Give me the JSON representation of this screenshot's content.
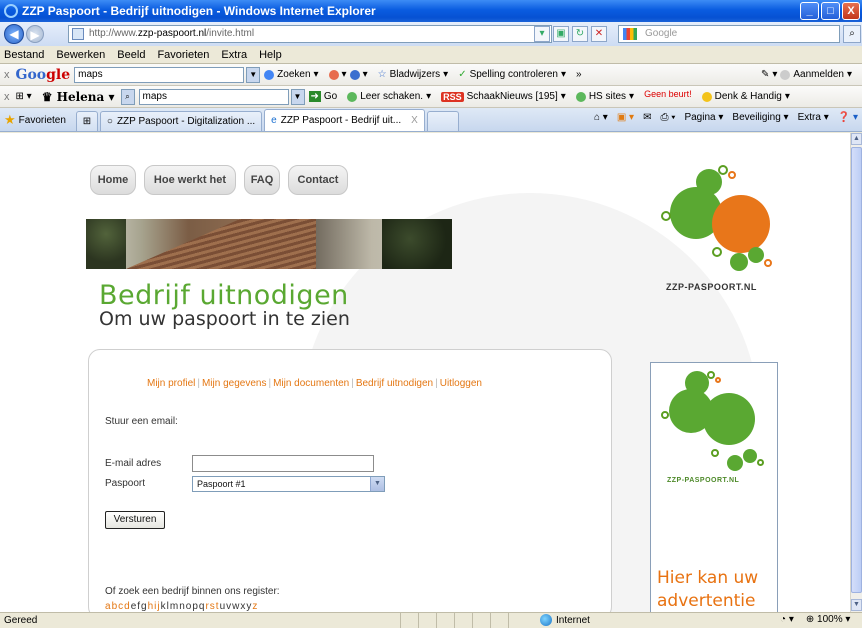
{
  "window": {
    "title": "ZZP Paspoort - Bedrijf uitnodigen - Windows Internet Explorer",
    "minimize": "_",
    "maximize": "□",
    "close": "X"
  },
  "address": {
    "url_prefix": "http://www.",
    "url_domain": "zzp-paspoort.nl",
    "url_path": "/invite.html",
    "search_placeholder": "Google",
    "back_icon": "arrow-left-icon",
    "forward_icon": "arrow-right-icon"
  },
  "menu": [
    "Bestand",
    "Bewerken",
    "Beeld",
    "Favorieten",
    "Extra",
    "Help"
  ],
  "google_toolbar": {
    "close": "x",
    "logo_g": "Goo",
    "logo_rest": "gle",
    "query": "maps",
    "zoeken": "Zoeken",
    "bladwijzers": "Bladwijzers",
    "spelling": "Spelling controleren",
    "more": "»",
    "aanmelden": "Aanmelden"
  },
  "second_toolbar": {
    "close": "x",
    "helena": "Helena",
    "query": "maps",
    "go": "Go",
    "leer": "Leer schaken.",
    "rss": "RSS",
    "schaak": "SchaakNieuws [195]",
    "hs": "HS sites",
    "geen": "Geen beurt!",
    "denk": "Denk & Handig"
  },
  "tabs": {
    "favorieten": "Favorieten",
    "tab1": "ZZP Paspoort - Digitalization ...",
    "tab2": "ZZP Paspoort - Bedrijf uit...",
    "tab2_close": "X",
    "pagina": "Pagina",
    "beveiliging": "Beveiliging",
    "extra": "Extra"
  },
  "page": {
    "nav": [
      "Home",
      "Hoe werkt het",
      "FAQ",
      "Contact"
    ],
    "heading": "Bedrijf uitnodigen",
    "subheading": "Om uw paspoort in te zien",
    "logo_text": "ZZP-PASPOORT.NL",
    "subnav": [
      "Mijn profiel",
      "Mijn gegevens",
      "Mijn documenten",
      "Bedrijf uitnodigen",
      "Uitloggen"
    ],
    "stuur": "Stuur een email:",
    "email_label": "E-mail adres",
    "email_value": "",
    "paspoort_label": "Paspoort",
    "paspoort_value": "Paspoort #1",
    "send": "Versturen",
    "ofzoek": "Of zoek een bedrijf binnen ons register:",
    "alphabet": [
      "a",
      "b",
      "c",
      "d",
      "e",
      "f",
      "g",
      "h",
      "i",
      "j",
      "k",
      "l",
      "m",
      "n",
      "o",
      "p",
      "q",
      "r",
      "s",
      "t",
      "u",
      "v",
      "w",
      "x",
      "y",
      "z"
    ],
    "alphabet_active": [
      "a",
      "b",
      "c",
      "d",
      "h",
      "i",
      "j",
      "r",
      "s",
      "t",
      "z"
    ],
    "ad_logo_text": "ZZP-PASPOORT.NL",
    "ad_line1": "Hier kan uw",
    "ad_line2": "advertentie"
  },
  "status": {
    "left": "Gereed",
    "zone": "Internet",
    "zoom": "100%"
  },
  "colors": {
    "accent_orange": "#e47713",
    "brand_green": "#5aa832",
    "titlebar_blue": "#0a5ce0"
  }
}
